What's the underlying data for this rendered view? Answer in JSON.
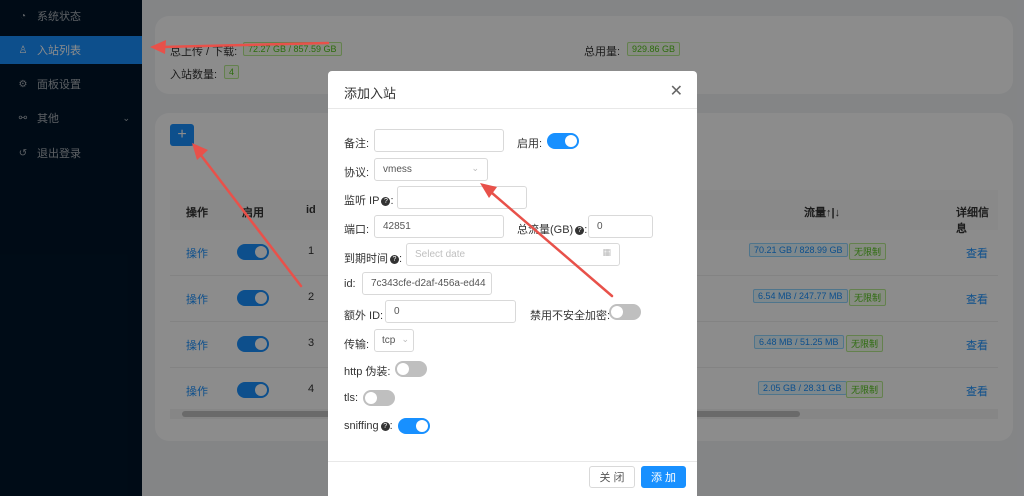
{
  "sidebar": {
    "items": [
      {
        "label": "系统状态",
        "icon": "dashboard-icon"
      },
      {
        "label": "入站列表",
        "icon": "user-icon",
        "active": true
      },
      {
        "label": "面板设置",
        "icon": "gear-icon"
      },
      {
        "label": "其他",
        "icon": "link-icon"
      },
      {
        "label": "退出登录",
        "icon": "logout-icon"
      }
    ]
  },
  "stats": {
    "upload_download_label": "总上传 / 下载:",
    "upload_download_value": "72.27 GB / 857.59 GB",
    "total_usage_label": "总用量:",
    "total_usage_value": "929.86 GB",
    "inbound_count_label": "入站数量:",
    "inbound_count_value": "4"
  },
  "table": {
    "headers": {
      "action": "操作",
      "enable": "启用",
      "id": "id",
      "traffic": "流量↑|↓",
      "details": "详细信息"
    },
    "rows": [
      {
        "action": "操作",
        "id": "1",
        "traffic": "70.21 GB / 828.99 GB",
        "limit": "无限制",
        "details": "查看"
      },
      {
        "action": "操作",
        "id": "2",
        "traffic": "6.54 MB / 247.77 MB",
        "limit": "无限制",
        "details": "查看"
      },
      {
        "action": "操作",
        "id": "3",
        "traffic": "6.48 MB / 51.25 MB",
        "limit": "无限制",
        "details": "查看"
      },
      {
        "action": "操作",
        "id": "4",
        "traffic": "2.05 GB / 28.31 GB",
        "limit": "无限制",
        "details": "查看"
      }
    ]
  },
  "modal": {
    "title": "添加入站",
    "remark_label": "备注:",
    "enable_label": "启用:",
    "protocol_label": "协议:",
    "protocol_value": "vmess",
    "listen_ip_label": "监听 IP",
    "port_label": "端口:",
    "port_value": "42851",
    "total_traffic_label": "总流量(GB)",
    "total_traffic_value": "0",
    "expiry_label": "到期时间",
    "expiry_placeholder": "Select date",
    "id_label": "id:",
    "id_value": "7c343cfe-d2af-456a-ed44",
    "alter_id_label": "额外 ID:",
    "alter_id_value": "0",
    "disable_insecure_label": "禁用不安全加密:",
    "transport_label": "传输:",
    "transport_value": "tcp",
    "http_label": "http 伪装:",
    "tls_label": "tls:",
    "sniffing_label": "sniffing",
    "close_button": "关 闭",
    "add_button": "添 加"
  },
  "colors": {
    "accent": "#1890ff",
    "sidebar_bg": "#001529",
    "annotation": "#e8514a"
  }
}
